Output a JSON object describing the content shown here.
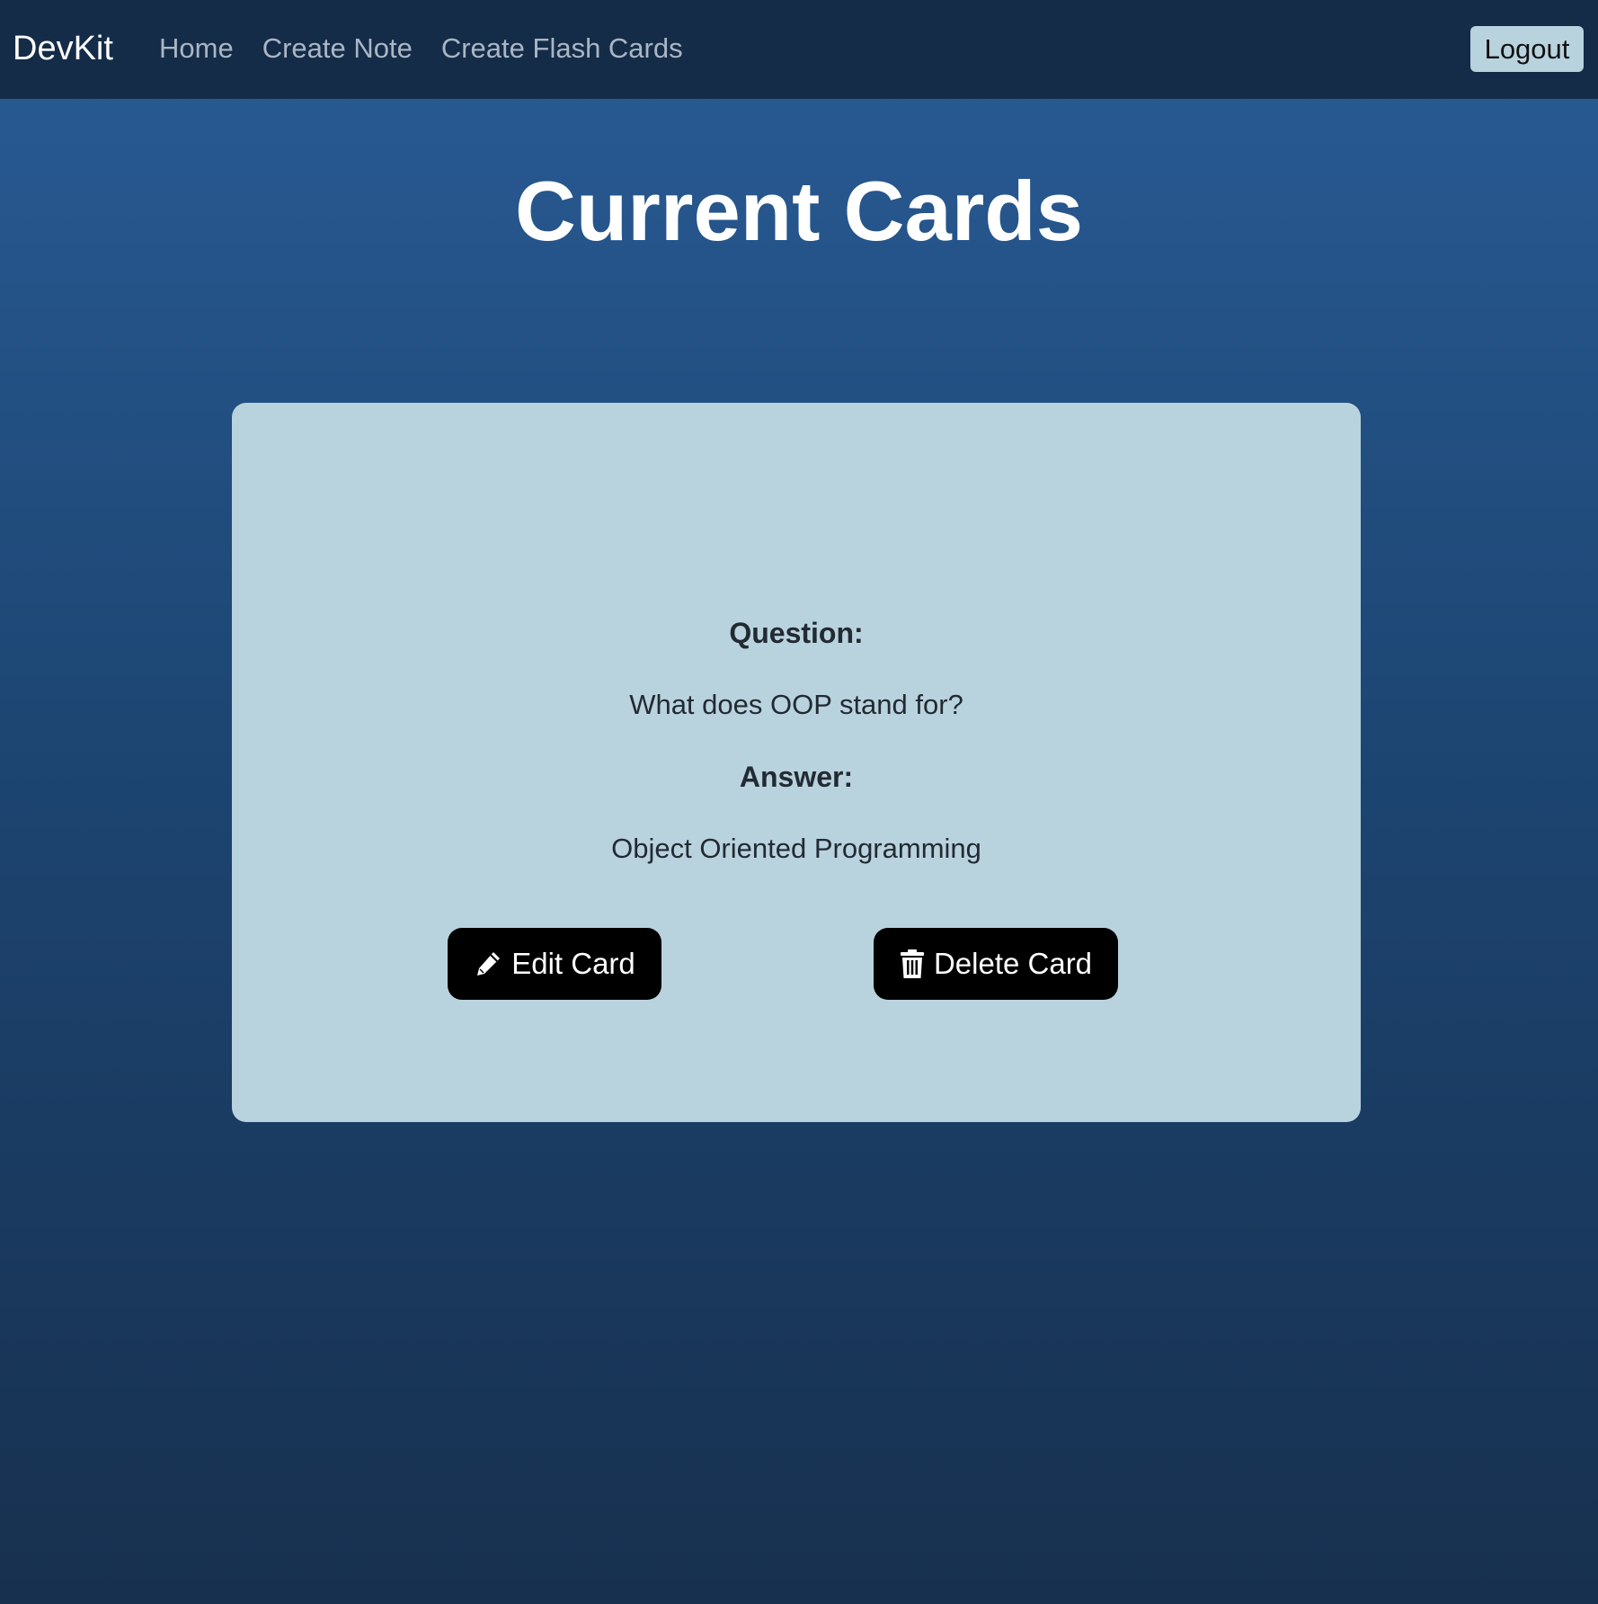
{
  "navbar": {
    "brand": "DevKit",
    "links": [
      {
        "label": "Home"
      },
      {
        "label": "Create Note"
      },
      {
        "label": "Create Flash Cards"
      }
    ],
    "logout_label": "Logout"
  },
  "page": {
    "title": "Current Cards"
  },
  "card": {
    "question_label": "Question:",
    "question": "What does OOP stand for?",
    "answer_label": "Answer:",
    "answer": "Object Oriented Programming",
    "edit_label": "Edit Card",
    "edit_icon": "pencil-icon",
    "delete_label": "Delete Card",
    "delete_icon": "trash-icon"
  },
  "colors": {
    "navbar_bg": "#142c48",
    "card_bg": "#b9d3de",
    "button_bg": "#000000",
    "logout_bg": "#b9d3de"
  }
}
